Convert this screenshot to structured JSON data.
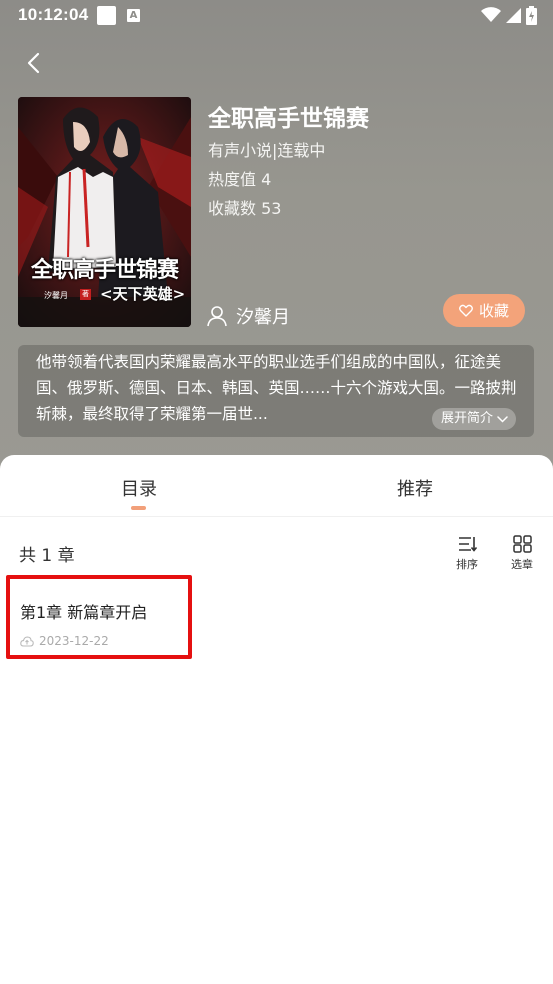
{
  "status_bar": {
    "time": "10:12:04",
    "a_icon_label": "A"
  },
  "book": {
    "title": "全职高手世锦赛",
    "type_line": "有声小说|连载中",
    "heat_line": "热度值 4",
    "favorites_line": "收藏数 53",
    "author": "汐馨月",
    "favorite_button": "收藏",
    "intro": "他带领着代表国内荣耀最高水平的职业选手们组成的中国队，征途美国、俄罗斯、德国、日本、韩国、英国……十六个游戏大国。一路披荆斩棘，最终取得了荣耀第一届世...",
    "expand_label": "展开简介"
  },
  "cover": {
    "title": "全职高手世锦赛",
    "subtitle": "<天下英雄>",
    "author": "汐馨月",
    "seal": "著"
  },
  "tabs": [
    {
      "label": "目录",
      "active": true
    },
    {
      "label": "推荐",
      "active": false
    }
  ],
  "catalog": {
    "count_label": "共 1 章",
    "sort_label": "排序",
    "select_label": "选章",
    "chapters": [
      {
        "title": "第1章 新篇章开启",
        "date": "2023-12-22"
      }
    ]
  },
  "colors": {
    "accent": "#f3a37a",
    "highlight_border": "#e51010",
    "header_bg": "#97968f"
  }
}
